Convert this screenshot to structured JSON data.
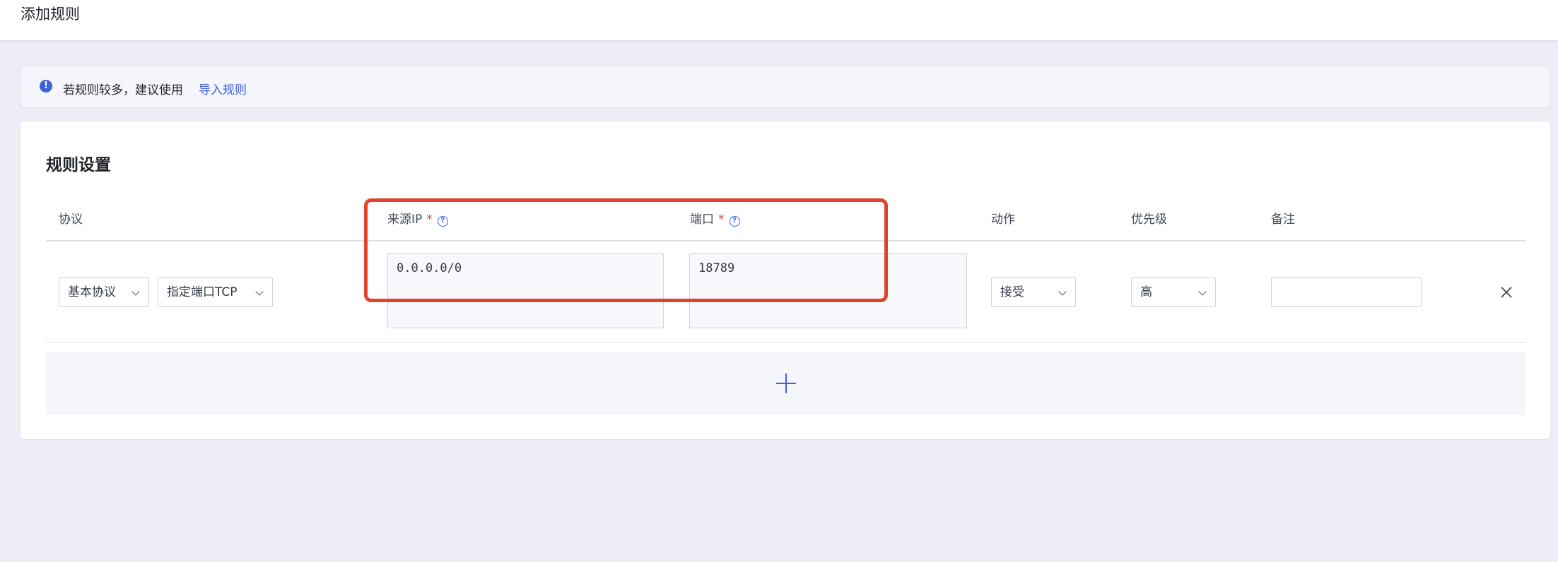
{
  "header": {
    "title": "添加规则"
  },
  "notice": {
    "message": "若规则较多，建议使用",
    "link": "导入规则",
    "icon": "info-icon"
  },
  "rules": {
    "section_title": "规则设置",
    "columns": {
      "protocol": "协议",
      "source_ip": "来源IP",
      "port": "端口",
      "action": "动作",
      "priority": "优先级",
      "remark": "备注",
      "required_mark": "*",
      "help_glyph": "?"
    },
    "row": {
      "protocol_type": "基本协议",
      "protocol_detail": "指定端口TCP",
      "source_ip": "0.0.0.0/0",
      "port": "18789",
      "action": "接受",
      "priority": "高",
      "remark": ""
    }
  },
  "colors": {
    "accent": "#3f62d8",
    "highlight": "#e2432c",
    "required": "#e34d3b"
  }
}
